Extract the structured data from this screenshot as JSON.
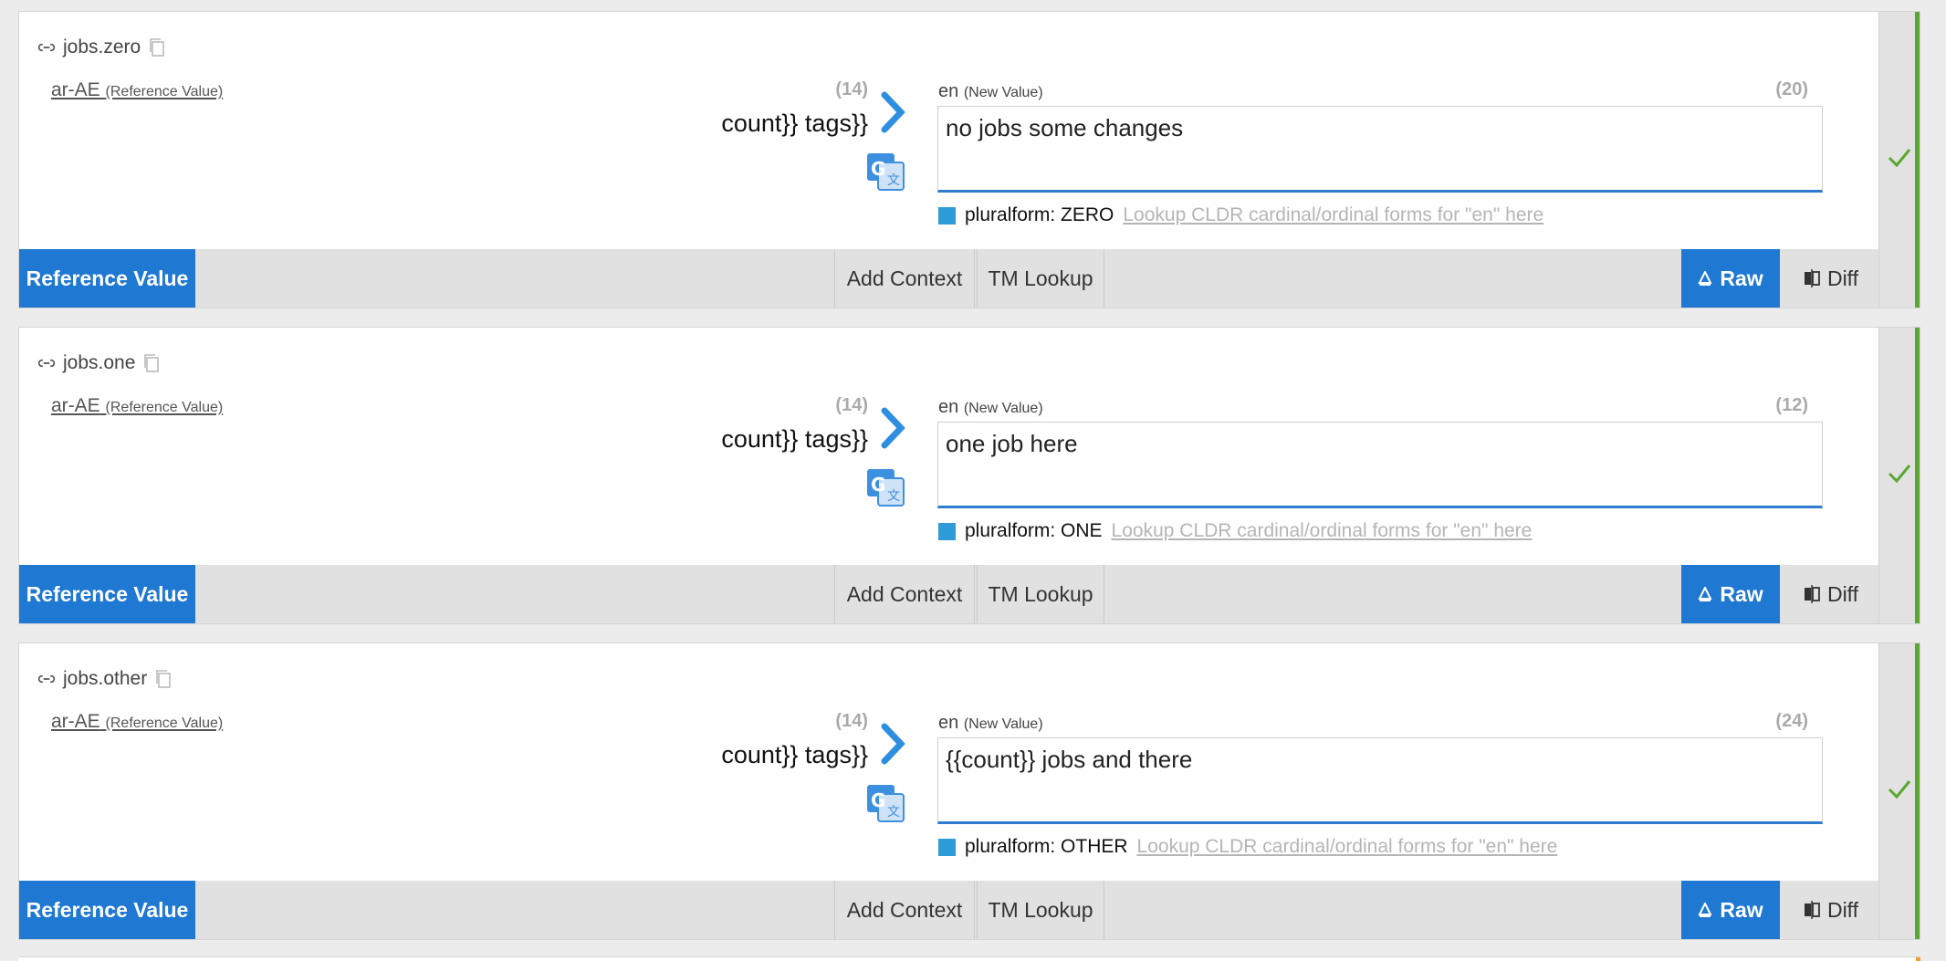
{
  "entries": [
    {
      "key": "jobs.zero",
      "ref_lang": "ar-AE",
      "ref_lang_note": "(Reference Value)",
      "ref_count": "(14)",
      "ref_text": "count}} tags}}",
      "new_lang": "en",
      "new_lang_note": "(New Value)",
      "new_count": "(20)",
      "new_value": "no jobs some changes",
      "plural_label": "pluralform: ZERO",
      "lookup_text": "Lookup CLDR cardinal/ordinal forms for \"en\" here"
    },
    {
      "key": "jobs.one",
      "ref_lang": "ar-AE",
      "ref_lang_note": "(Reference Value)",
      "ref_count": "(14)",
      "ref_text": "count}} tags}}",
      "new_lang": "en",
      "new_lang_note": "(New Value)",
      "new_count": "(12)",
      "new_value": "one job here",
      "plural_label": "pluralform: ONE",
      "lookup_text": "Lookup CLDR cardinal/ordinal forms for \"en\" here"
    },
    {
      "key": "jobs.other",
      "ref_lang": "ar-AE",
      "ref_lang_note": "(Reference Value)",
      "ref_count": "(14)",
      "ref_text": "count}} tags}}",
      "new_lang": "en",
      "new_lang_note": "(New Value)",
      "new_count": "(24)",
      "new_value": "{{count}} jobs and there",
      "plural_label": "pluralform: OTHER",
      "lookup_text": "Lookup CLDR cardinal/ordinal forms for \"en\" here"
    }
  ],
  "toolbar": {
    "reference_value": "Reference Value",
    "add_context": "Add Context",
    "tm_lookup": "TM Lookup",
    "raw": "Raw",
    "diff": "Diff"
  },
  "colors": {
    "accent_blue": "#1f78d1",
    "success_green": "#5aa830",
    "plural_square": "#2e9cd8"
  },
  "icons": [
    "link-icon",
    "copy-icon",
    "chevron-right-icon",
    "google-translate-icon",
    "check-icon",
    "raw-icon",
    "diff-icon"
  ]
}
